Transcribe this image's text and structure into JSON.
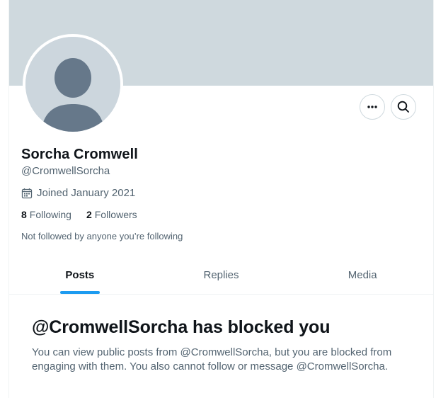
{
  "profile": {
    "name": "Sorcha Cromwell",
    "handle": "@CromwellSorcha",
    "joined": "Joined January 2021",
    "following_count": "8",
    "following_label": "Following",
    "followers_count": "2",
    "followers_label": "Followers",
    "not_followed_note": "Not followed by anyone you’re following"
  },
  "actions": {
    "more_icon": "more-horizontal-icon",
    "search_icon": "search-icon"
  },
  "tabs": [
    {
      "label": "Posts",
      "active": true
    },
    {
      "label": "Replies",
      "active": false
    },
    {
      "label": "Media",
      "active": false
    }
  ],
  "blocked": {
    "title": "@CromwellSorcha has blocked you",
    "body": "You can view public posts from @CromwellSorcha, but you are blocked from engaging with them. You also cannot follow or message @CromwellSorcha."
  },
  "colors": {
    "banner": "#cfd9de",
    "accent": "#1d9bf0",
    "text_primary": "#0f1419",
    "text_secondary": "#536471"
  }
}
